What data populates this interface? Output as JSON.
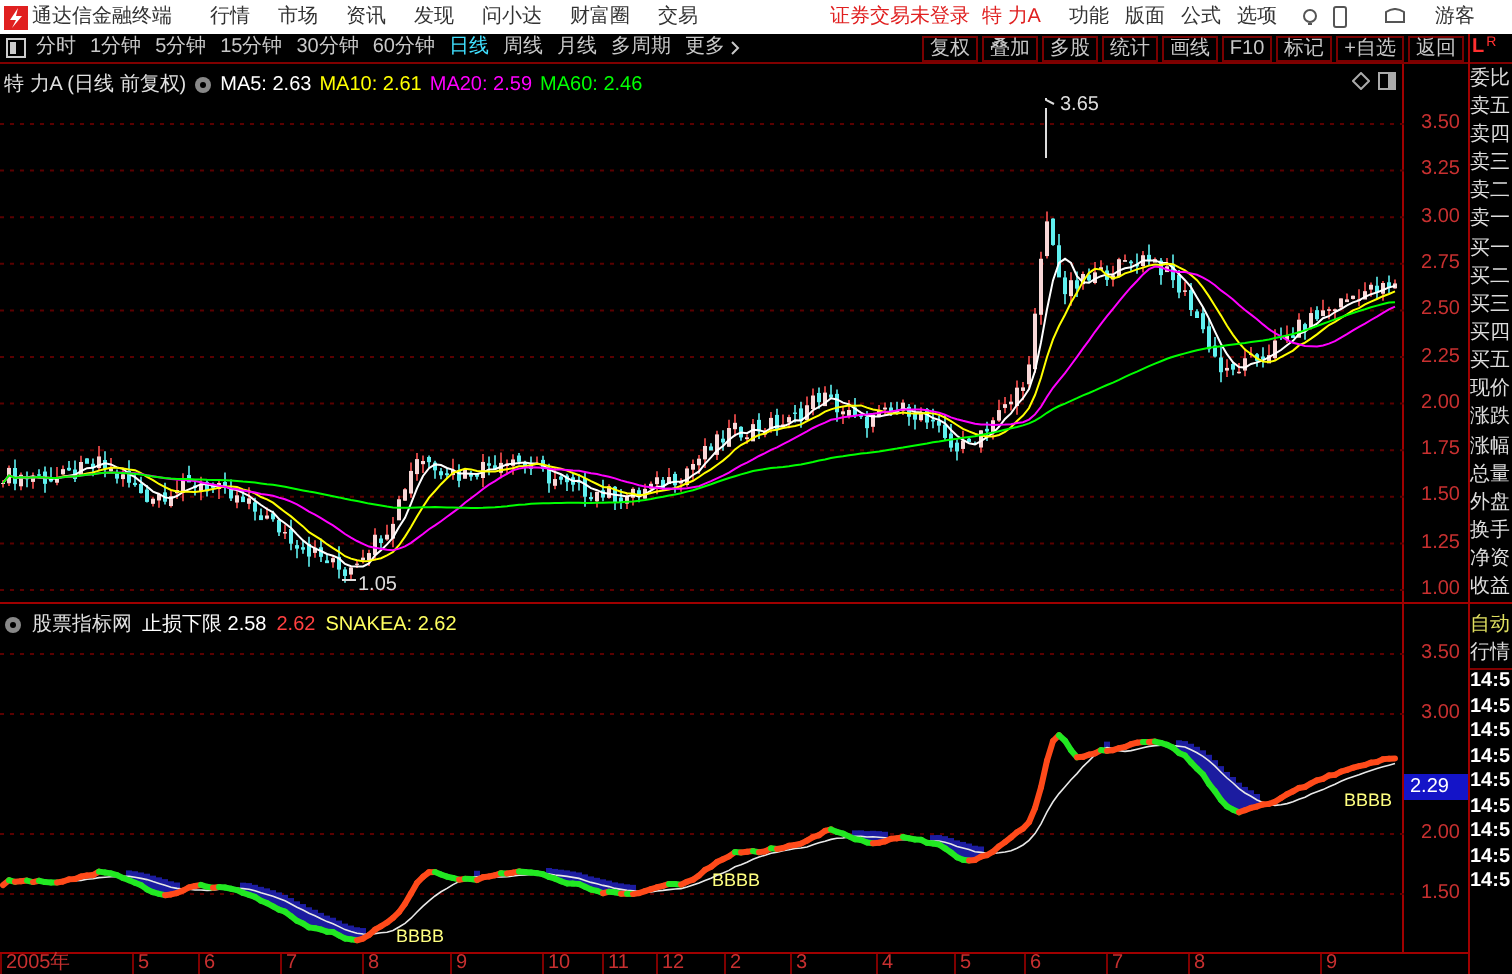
{
  "app_bar": {
    "app_name": "通达信金融终端",
    "menu": [
      "行情",
      "市场",
      "资讯",
      "发现",
      "问小达",
      "财富圈",
      "交易"
    ],
    "login_status": "证券交易未登录",
    "stock_name": "特 力A",
    "right_menu": [
      "功能",
      "版面",
      "公式",
      "选项"
    ],
    "user": "游客"
  },
  "toolbar": {
    "periods": [
      {
        "label": "分时",
        "selected": false
      },
      {
        "label": "1分钟",
        "selected": false
      },
      {
        "label": "5分钟",
        "selected": false
      },
      {
        "label": "15分钟",
        "selected": false
      },
      {
        "label": "30分钟",
        "selected": false
      },
      {
        "label": "60分钟",
        "selected": false
      },
      {
        "label": "日线",
        "selected": true
      },
      {
        "label": "周线",
        "selected": false
      },
      {
        "label": "月线",
        "selected": false
      },
      {
        "label": "多周期",
        "selected": false
      },
      {
        "label": "更多",
        "selected": false
      }
    ],
    "actions": [
      "复权",
      "叠加",
      "多股",
      "统计",
      "画线",
      "F10",
      "标记",
      "+自选",
      "返回"
    ]
  },
  "main_chart": {
    "title": "特 力A (日线 前复权)",
    "indicators": [
      {
        "label": "MA5: 2.63",
        "color": "#ffffff"
      },
      {
        "label": "MA10: 2.61",
        "color": "#ffff00"
      },
      {
        "label": "MA20: 2.59",
        "color": "#ff00ff"
      },
      {
        "label": "MA60: 2.46",
        "color": "#00ff00"
      }
    ],
    "price_axis": [
      "3.50",
      "3.25",
      "3.00",
      "2.75",
      "2.50",
      "2.25",
      "2.00",
      "1.75",
      "1.50",
      "1.25",
      "1.00"
    ],
    "high_label": "3.65",
    "low_label": "1.05"
  },
  "indicator_pane": {
    "title": "股票指标网",
    "readings": [
      {
        "label": "止损下限 2.58",
        "color": "#ffffff"
      },
      {
        "label": "2.62",
        "color": "#ff4040"
      },
      {
        "label": "SNAKEA: 2.62",
        "color": "#ffff60"
      }
    ],
    "axis": [
      "3.50",
      "3.00",
      "2.00",
      "1.50"
    ],
    "current_value": "2.29",
    "signal_labels": [
      "BBBB",
      "BBBB",
      "BBBB"
    ]
  },
  "time_axis": [
    "2005年",
    "5",
    "6",
    "7",
    "8",
    "9",
    "10",
    "11",
    "12",
    "2",
    "3",
    "4",
    "5",
    "6",
    "7",
    "8",
    "9"
  ],
  "side_panel": {
    "header": [
      "L",
      "R"
    ],
    "quote_labels": [
      "委比",
      "卖五",
      "卖四",
      "卖三",
      "卖二",
      "卖一",
      "买一",
      "买二",
      "买三",
      "买四",
      "买五",
      "现价",
      "涨跌",
      "涨幅",
      "总量",
      "外盘",
      "换手",
      "净资",
      "收益"
    ],
    "mode": "自动",
    "section": "行情",
    "times": [
      "14:5",
      "14:5",
      "14:5",
      "14:5",
      "14:5",
      "14:5",
      "14:5",
      "14:5",
      "14:5"
    ]
  }
}
